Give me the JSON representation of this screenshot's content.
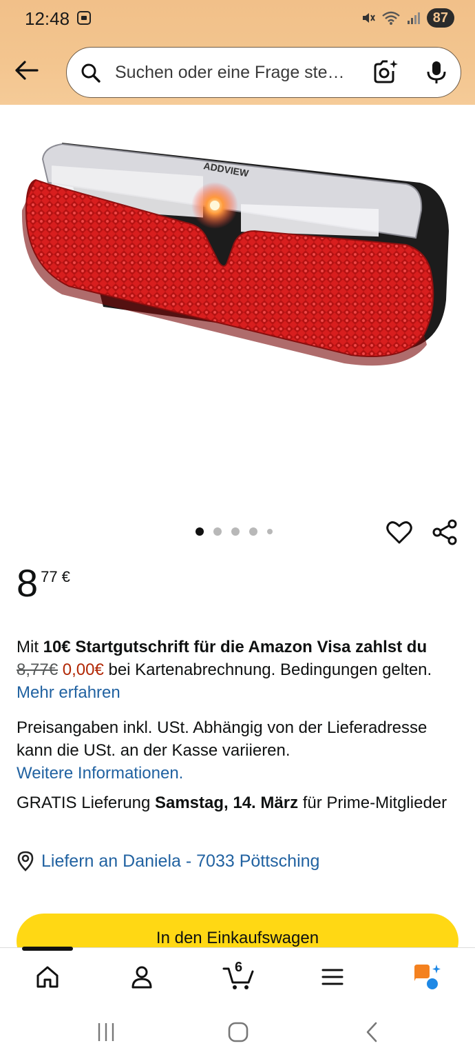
{
  "status_bar": {
    "time": "12:48",
    "battery": "87"
  },
  "search": {
    "placeholder": "Suchen oder eine Frage ste…"
  },
  "icons": {
    "back": "arrow-left-icon",
    "search": "search-icon",
    "camera": "camera-lens-icon",
    "mic": "microphone-icon",
    "heart": "heart-icon",
    "share": "share-icon",
    "pin": "location-pin-icon",
    "home": "home-icon",
    "account": "person-icon",
    "cart": "cart-icon",
    "menu": "menu-icon",
    "assistant": "rufus-assistant-icon"
  },
  "image_carousel": {
    "total": 5,
    "active_index": 0
  },
  "price": {
    "whole": "8",
    "fraction": "77",
    "currency": "€"
  },
  "promo": {
    "prefix": "Mit ",
    "bold": "10€ Startgutschrift für die Amazon Visa zahlst du",
    "old_price": "8,77€",
    "new_price": "0,00€",
    "suffix": " bei Kartenabrechnung. Bedingungen gelten.",
    "link": "Mehr erfahren"
  },
  "tax": {
    "text": "Preisangaben inkl. USt. Abhängig von der Lieferadresse kann die USt. an der Kasse variieren.",
    "link": "Weitere Informationen."
  },
  "delivery": {
    "prefix": "GRATIS Lieferung ",
    "date": "Samstag, 14. März",
    "suffix": " für Prime-Mitglieder"
  },
  "deliver_to": {
    "label": "Liefern an Daniela - 7033 Pöttsching"
  },
  "cart_button": {
    "label": "In den Einkaufswagen"
  },
  "bottom_nav": {
    "cart_count": "6"
  },
  "colors": {
    "header_bg": "#f3c58f",
    "cart_button": "#ffd814",
    "link": "#2162a1",
    "price_red": "#b12704",
    "assistant_orange": "#f4811f",
    "assistant_blue": "#1e88e5"
  }
}
